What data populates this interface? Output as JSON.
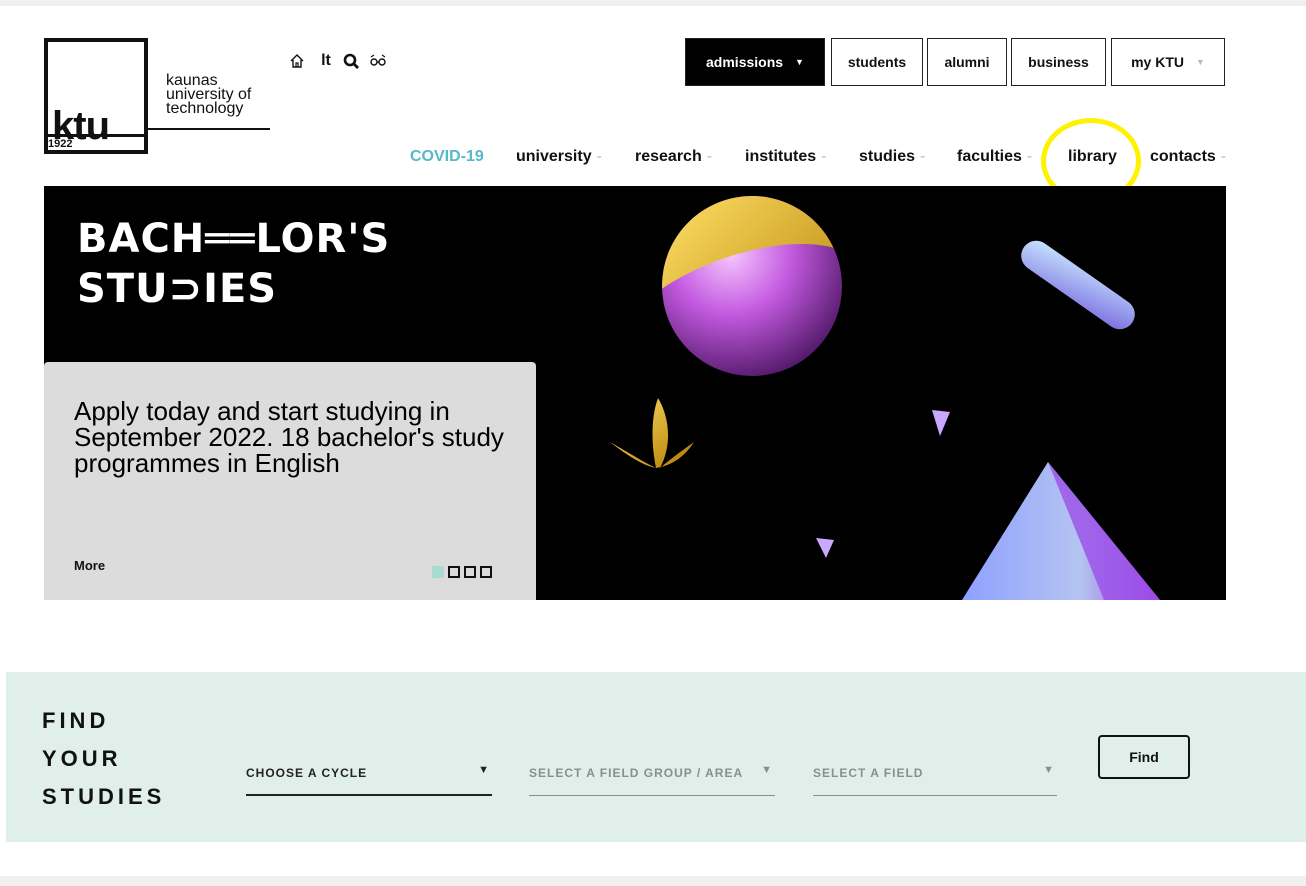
{
  "logo": {
    "short": "ktu",
    "year": "1922",
    "name_lines": [
      "kaunas",
      "university of",
      "technology"
    ]
  },
  "utility": {
    "home_icon": "home-icon",
    "lang": "lt",
    "search_icon": "search-icon",
    "accessibility_icon": "accessibility-icon"
  },
  "top_buttons": {
    "admissions": "admissions",
    "students": "students",
    "alumni": "alumni",
    "business": "business",
    "my_ktu": "my KTU"
  },
  "nav": {
    "covid": "COVID-19",
    "university": "university",
    "research": "research",
    "institutes": "institutes",
    "studies": "studies",
    "faculties": "faculties",
    "library": "library",
    "contacts": "contacts",
    "dash": "-"
  },
  "hero": {
    "title_line1": "BACH══LOR'S",
    "title_line2": "STU⊃IES",
    "text": "Apply today and start studying in September 2022. 18 bachelor's study programmes in English",
    "more": "More",
    "slides": 4,
    "active_slide": 1
  },
  "find": {
    "title_lines": [
      "FIND",
      "YOUR",
      "STUDIES"
    ],
    "cycle_placeholder": "CHOOSE A CYCLE",
    "field_group_placeholder": "SELECT A FIELD GROUP / AREA",
    "field_placeholder": "SELECT A FIELD",
    "button": "Find"
  },
  "colors": {
    "accent_teal": "#56b9c8",
    "band_bg": "#e0efe9",
    "highlight": "#fff200"
  }
}
